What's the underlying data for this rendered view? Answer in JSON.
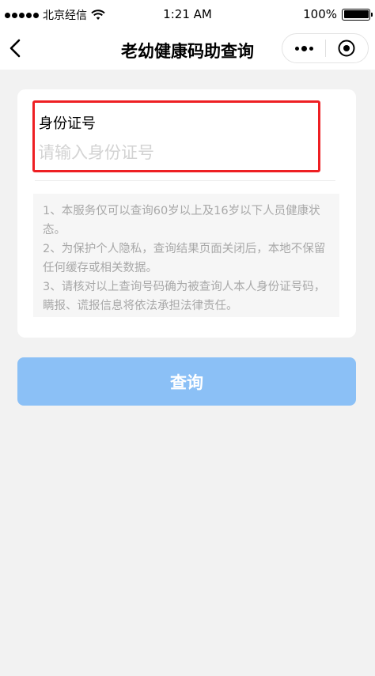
{
  "status_bar": {
    "carrier": "北京经信",
    "time": "1:21 AM",
    "battery": "100%"
  },
  "nav": {
    "title": "老幼健康码助查询",
    "back_icon": "chevron-left-icon",
    "more_icon": "more-dots-icon",
    "close_icon": "target-circle-icon"
  },
  "form": {
    "id_label": "身份证号",
    "id_placeholder": "请输入身份证号",
    "id_value": ""
  },
  "notice": {
    "lines": [
      "1、本服务仅可以查询60岁以上及16岁以下人员健康状态。",
      "2、为保护个人隐私，查询结果页面关闭后，本地不保留任何缓存或相关数据。",
      "3、请核对以上查询号码确为被查询人本人身份证号码，瞒报、谎报信息将依法承担法律责任。"
    ]
  },
  "submit": {
    "label": "查询"
  },
  "colors": {
    "background": "#f2f2f2",
    "highlight": "#ee1f23",
    "button": "#8bc0f6",
    "notice_text": "#a8a8a8",
    "placeholder": "#d3d3d3"
  }
}
